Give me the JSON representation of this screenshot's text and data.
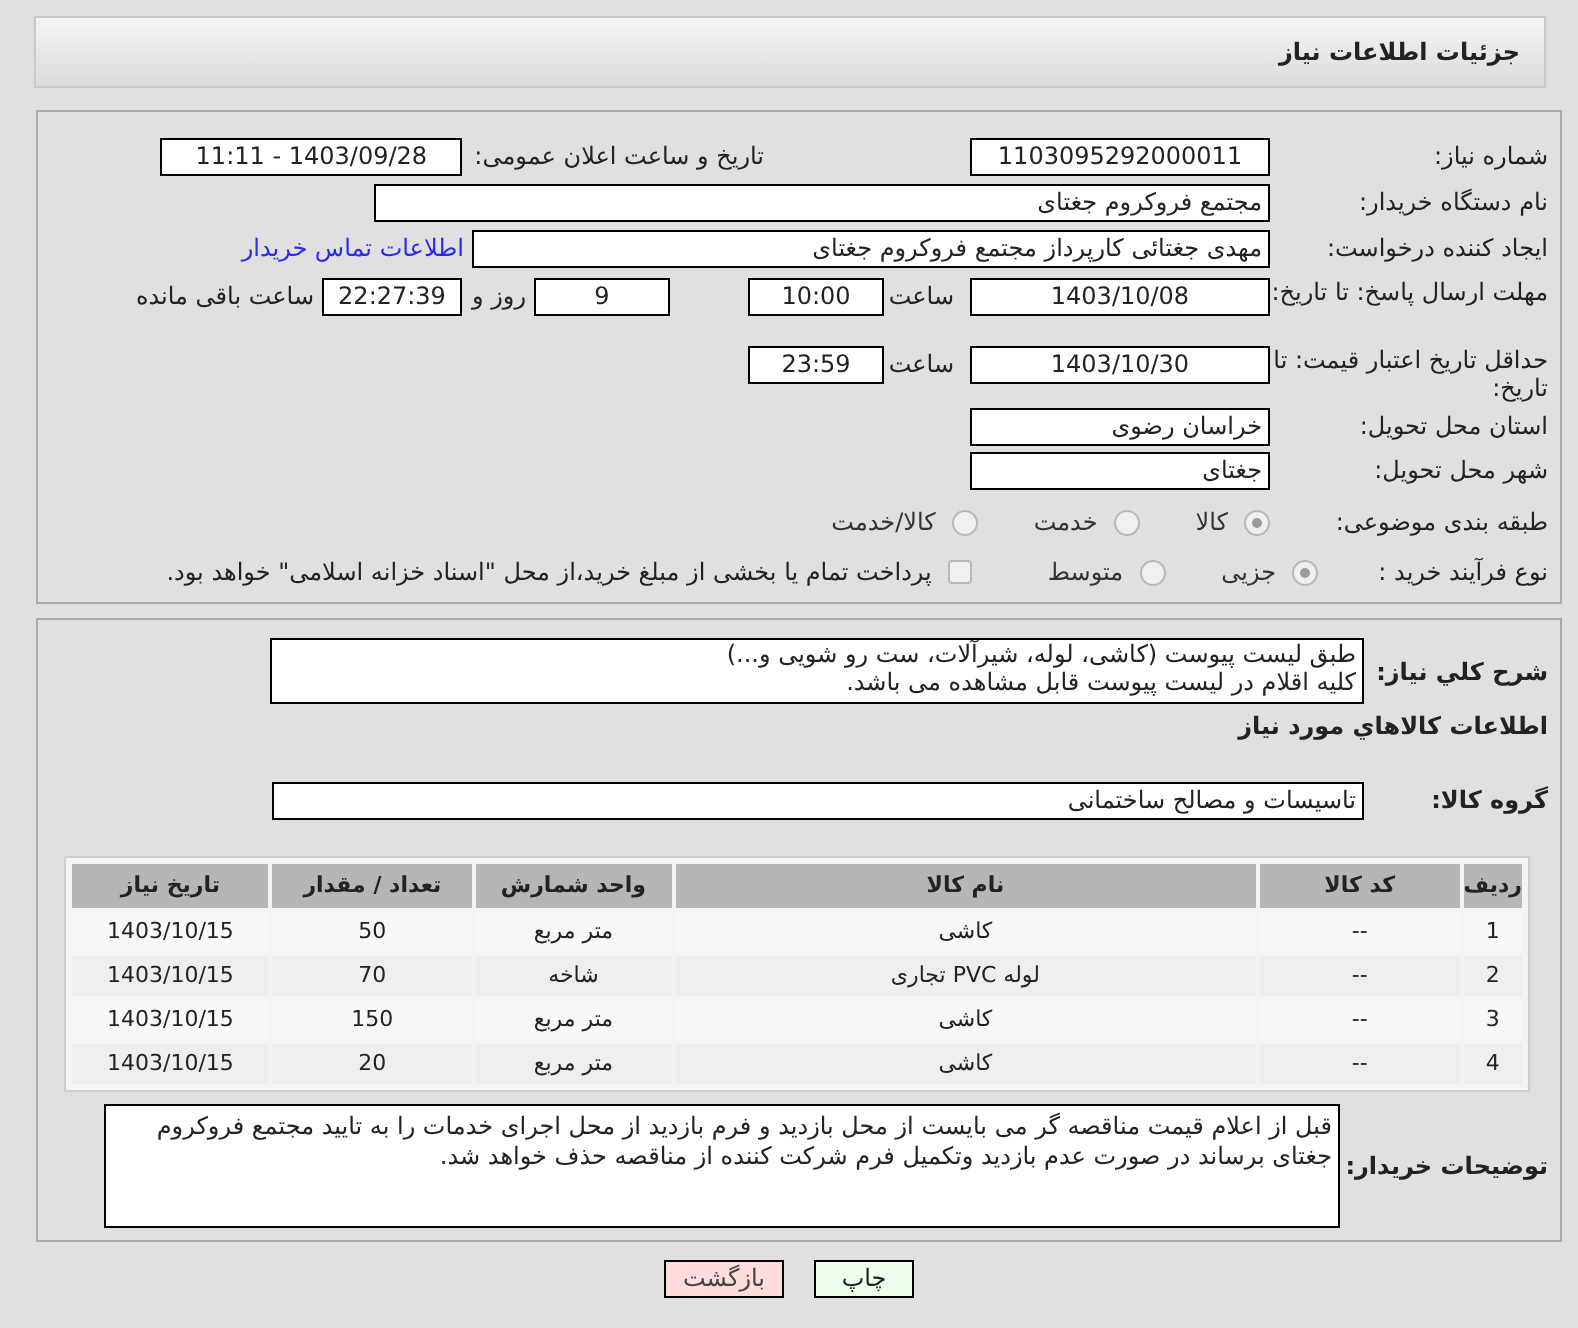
{
  "header": {
    "title": "جزئیات اطلاعات نیاز"
  },
  "need_number": {
    "label": "شماره نیاز:",
    "value": "1103095292000011"
  },
  "announce_datetime": {
    "label": "تاریخ و ساعت اعلان عمومی:",
    "value": "1403/09/28 - 11:11"
  },
  "buyer_org": {
    "label": "نام دستگاه خریدار:",
    "value": "مجتمع فروکروم جغتای"
  },
  "requester": {
    "label": "ایجاد کننده درخواست:",
    "value": "مهدی جغتائی کارپرداز مجتمع فروکروم جغتای",
    "link": "اطلاعات تماس خریدار"
  },
  "response_deadline": {
    "label": "مهلت ارسال پاسخ: تا تاریخ:",
    "date": "1403/10/08",
    "time_label": "ساعت",
    "time": "10:00",
    "days": "9",
    "days_label": "روز و",
    "remaining": "22:27:39",
    "remaining_label": "ساعت باقی مانده"
  },
  "price_validity": {
    "label": "حداقل تاریخ اعتبار قیمت: تا تاریخ:",
    "date": "1403/10/30",
    "time_label": "ساعت",
    "time": "23:59"
  },
  "province": {
    "label": "استان محل تحویل:",
    "value": "خراسان رضوی"
  },
  "city": {
    "label": "شهر محل تحویل:",
    "value": "جغتای"
  },
  "category": {
    "label": "طبقه بندی موضوعی:",
    "options": [
      {
        "label": "کالا",
        "selected": true
      },
      {
        "label": "خدمت",
        "selected": false
      },
      {
        "label": "کالا/خدمت",
        "selected": false
      }
    ]
  },
  "purchase_process": {
    "label": "نوع فرآیند خرید :",
    "options": [
      {
        "label": "جزیی",
        "selected": true
      },
      {
        "label": "متوسط",
        "selected": false
      }
    ],
    "payment_option": {
      "label": "پرداخت تمام یا بخشی از مبلغ خرید،از محل \"اسناد خزانه اسلامی\" خواهد بود.",
      "checked": false
    }
  },
  "description": {
    "label": "شرح کلي نیاز:",
    "text": "طبق لیست پیوست (کاشی، لوله، شیرآلات، ست رو شویی و...)\nکلیه اقلام در لیست پیوست قابل مشاهده می باشد."
  },
  "goods_section_title": "اطلاعات کالاهاي مورد نیاز",
  "goods_group": {
    "label": "گروه کالا:",
    "value": "تاسیسات و مصالح ساختمانی"
  },
  "table": {
    "columns": [
      "ردیف",
      "کد کالا",
      "نام کالا",
      "واحد شمارش",
      "تعداد / مقدار",
      "تاریخ نیاز"
    ],
    "rows": [
      [
        "1",
        "--",
        "کاشی",
        "متر مربع",
        "50",
        "1403/10/15"
      ],
      [
        "2",
        "--",
        "لوله PVC تجاری",
        "شاخه",
        "70",
        "1403/10/15"
      ],
      [
        "3",
        "--",
        "کاشی",
        "متر مربع",
        "150",
        "1403/10/15"
      ],
      [
        "4",
        "--",
        "کاشی",
        "متر مربع",
        "20",
        "1403/10/15"
      ]
    ]
  },
  "buyer_notes": {
    "label": "توضیحات خریدار:",
    "text": "قبل از اعلام قیمت مناقصه گر می بایست از محل بازدید و فرم بازدید از محل اجرای خدمات را به تایید مجتمع فروکروم جغتای برساند در صورت عدم بازدید وتکمیل فرم شرکت کننده از مناقصه حذف خواهد شد."
  },
  "buttons": [
    {
      "label": "چاپ",
      "kind": "print"
    },
    {
      "label": "بازگشت",
      "kind": "back"
    }
  ]
}
